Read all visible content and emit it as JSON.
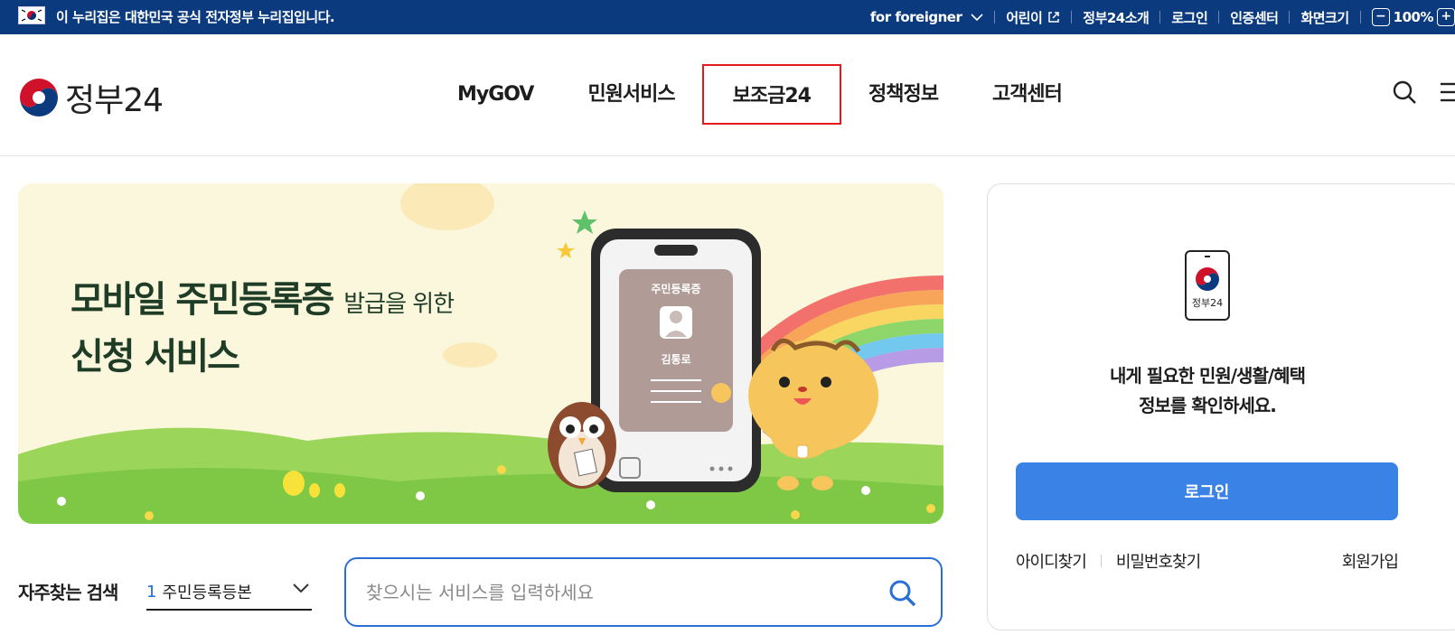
{
  "govbar": {
    "notice": "이 누리집은 대한민국 공식 전자정부 누리집입니다.",
    "links": [
      "for foreigner",
      "어린이",
      "정부24소개",
      "로그인",
      "인증센터",
      "화면크기"
    ],
    "zoom_value": "100%",
    "zoom_minus": "−",
    "zoom_plus": "+"
  },
  "header": {
    "logo_text": "정부24",
    "nav": [
      "MyGOV",
      "민원서비스",
      "보조금24",
      "정책정보",
      "고객센터"
    ],
    "active_nav": "보조금24"
  },
  "banner": {
    "title_line1": "모바일 주민등록증",
    "title_sub": "발급을 위한",
    "title_line2": "신청 서비스",
    "card_title": "주민등록증",
    "card_name": "김통로"
  },
  "search": {
    "frequent_label": "자주찾는 검색",
    "frequent_rank": "1",
    "frequent_value": "주민등록등본",
    "placeholder": "찾으시는 서비스를 입력하세요"
  },
  "login_panel": {
    "icon_label": "정부24",
    "message_line1": "내게 필요한 민원/생활/혜택",
    "message_line2": "정보를 확인하세요.",
    "login_button": "로그인",
    "find_id": "아이디찾기",
    "find_password": "비밀번호찾기",
    "signup": "회원가입"
  },
  "colors": {
    "govbar_bg": "#0b3a7e",
    "accent_blue": "#3a82e6",
    "active_outline": "#e51b1b"
  }
}
